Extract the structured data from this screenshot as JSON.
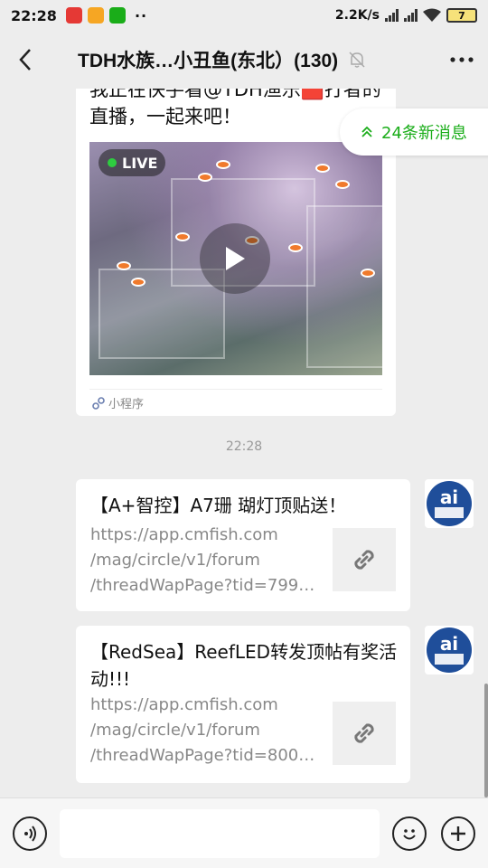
{
  "status_bar": {
    "time": "22:28",
    "network_speed": "2.2K/s",
    "battery": "7",
    "app_icons": [
      "news-app-icon",
      "notes-app-icon",
      "shield-app-icon"
    ]
  },
  "header": {
    "title": "TDH水族…小丑鱼(东北）(130)",
    "muted": true
  },
  "new_messages_banner": {
    "label": "24条新消息"
  },
  "shared_card": {
    "description": "我正在快手看@TDH渔乐🟥打者的直播，一起来吧！",
    "live_badge": "LIVE",
    "source_label": "小程序"
  },
  "timestamp": "22:28",
  "messages": [
    {
      "title": "【A+智控】A7珊 瑚灯顶贴送！",
      "url": "https://app.cmfish.com\n/mag/circle/v1/forum\n/threadWapPage?tid=799…"
    },
    {
      "title": "【RedSea】ReefLED转发顶帖有奖活动!!!",
      "url": "https://app.cmfish.com\n/mag/circle/v1/forum\n/threadWapPage?tid=800…"
    }
  ],
  "colors": {
    "accent": "#1aad19",
    "background": "#ededed",
    "bubble": "#ffffff",
    "avatar_blue": "#1f4e9a"
  },
  "input_bar": {
    "placeholder": ""
  }
}
